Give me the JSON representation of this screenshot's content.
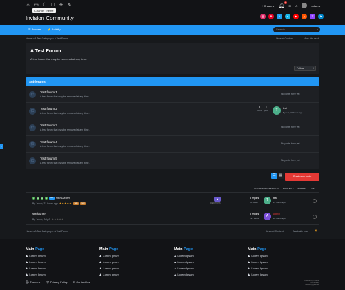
{
  "topbar": {
    "site_title": "Invision Community",
    "tooltip": "Change Theme",
    "create_label": "Create",
    "notification_count": "1",
    "user_name": "adam",
    "icons": [
      "home-icon",
      "controller-icon",
      "moon-icon",
      "window-icon",
      "sun-icon",
      "brush-icon"
    ],
    "social": [
      {
        "name": "instagram-icon",
        "color": "#e1306c",
        "glyph": "◎"
      },
      {
        "name": "pinterest-icon",
        "color": "#e60023",
        "glyph": "P"
      },
      {
        "name": "twitter-icon",
        "color": "#1da1f2",
        "glyph": "t"
      },
      {
        "name": "vimeo-icon",
        "color": "#1ab7ea",
        "glyph": "v"
      },
      {
        "name": "youtube-icon",
        "color": "#ff0000",
        "glyph": "▶"
      },
      {
        "name": "soundcloud-icon",
        "color": "#ff5500",
        "glyph": "☁"
      },
      {
        "name": "twitch-icon",
        "color": "#9146ff",
        "glyph": "T"
      },
      {
        "name": "telegram-icon",
        "color": "#0088cc",
        "glyph": "➤"
      }
    ]
  },
  "nav": {
    "browse": "Browse",
    "activity": "Activity",
    "search_placeholder": "Search..."
  },
  "breadcrumb": {
    "top": "Home  >  A Test Category  >  A Test Forum",
    "bottom": "Home  >  A Test Category  >  A Test Forum",
    "unread": "Unread Content",
    "mark_read": "Mark site read"
  },
  "forum": {
    "title": "A Test Forum",
    "description": "A test forum that may be removed at any time.",
    "follow": "Follow",
    "follow_count": "0"
  },
  "subforums": {
    "heading": "Subforums",
    "rows": [
      {
        "name": "Test forum 1",
        "desc": "A test forum that may be removed at any time.",
        "empty": "No posts here yet",
        "posts": "",
        "replies": "",
        "last_author": "",
        "last_by": ""
      },
      {
        "name": "Test forum 2",
        "desc": "A test forum that may be removed at any time.",
        "empty": "",
        "posts": "1",
        "replies": "1",
        "posts_label": "topic",
        "replies_label": "post",
        "last_author": "test",
        "last_by": "By test, 21 hours ago",
        "avatar_letter": "T"
      },
      {
        "name": "Test forum 3",
        "desc": "A test forum that may be removed at any time.",
        "empty": "No posts here yet"
      },
      {
        "name": "Test forum 4",
        "desc": "A test forum that may be removed at any time.",
        "empty": "No posts here yet"
      },
      {
        "name": "Test forum 5",
        "desc": "A test forum that may be removed at any time.",
        "empty": "No posts here yet"
      }
    ]
  },
  "actions": {
    "start_topic": "Start new topic"
  },
  "sort": {
    "mark_read": "✓ MARK FORUM AS READ",
    "sort_by": "SORT BY ▾",
    "filter": "FILTER ▾"
  },
  "topics": [
    {
      "title": "Welcome!",
      "tag": "test",
      "by": "By Jakob, 21 hours ago",
      "tags": [
        "tags",
        "test"
      ],
      "replies": "3 replies",
      "views": "20 views",
      "last_author": "test",
      "last_time": "21 hours ago",
      "avatar_letter": "T",
      "avatar_color": "#4caf8a",
      "last_color": "#ffffff",
      "reaction_label": "REACTIONS",
      "rating": "5 of 5 stars"
    },
    {
      "title": "Welcome!",
      "by": "By Jakob, July 6",
      "replies": "3 replies",
      "views": "197 views",
      "last_author": "Admin",
      "last_time": "20 hours ago",
      "avatar_letter": "A",
      "avatar_color": "#7b4fd8",
      "last_color": "#e53935"
    }
  ],
  "footer": {
    "columns": [
      {
        "title_a": "Main ",
        "title_b": "Page",
        "links": [
          "Lorem Ipsum",
          "Lorem Ipsum",
          "Lorem Ipsum",
          "Lorem Ipsum"
        ]
      },
      {
        "title_a": "Main ",
        "title_b": "Page",
        "links": [
          "Lorem Ipsum",
          "Lorem Ipsum",
          "Lorem Ipsum",
          "Lorem Ipsum"
        ]
      },
      {
        "title_a": "Main ",
        "title_b": "Page",
        "links": [
          "Lorem Ipsum",
          "Lorem Ipsum",
          "Lorem Ipsum",
          "Lorem Ipsum"
        ]
      },
      {
        "title_a": "Main ",
        "title_b": "Page",
        "links": [
          "Lorem Ipsum",
          "Lorem Ipsum",
          "Lorem Ipsum",
          "Lorem Ipsum"
        ]
      }
    ],
    "theme": "Theme ▾",
    "privacy": "Privacy Policy",
    "contact": "Contact Us",
    "powered": "Powered by Invision Community",
    "theme_by": "Theme by ipbmafia"
  },
  "colors": {
    "accent": "#2196f3",
    "danger": "#e53935",
    "bg": "#17191c"
  }
}
